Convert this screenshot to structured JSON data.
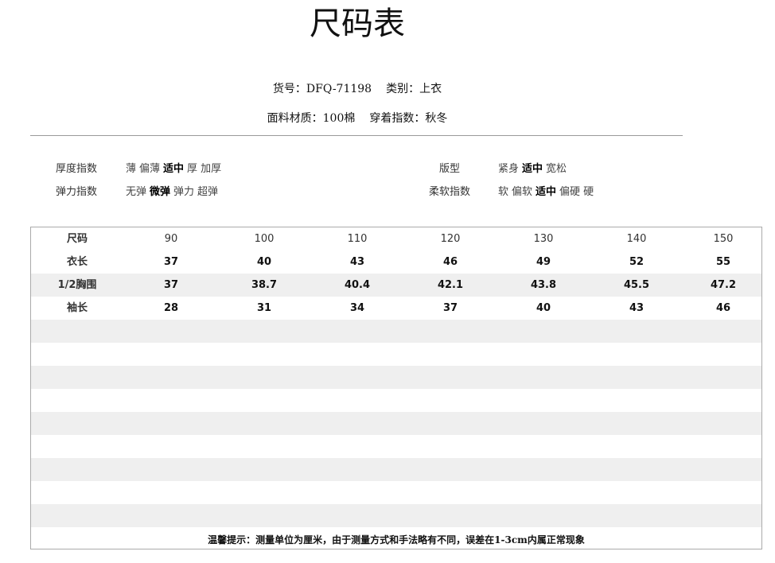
{
  "title": "尺码表",
  "info": {
    "item_no_label": "货号：",
    "item_no": "DFQ-71198",
    "category_label": "类别：",
    "category": "上衣",
    "fabric_label": "面料材质：",
    "fabric": "100棉",
    "season_label": "穿着指数：",
    "season": "秋冬"
  },
  "attributes": {
    "thickness": {
      "label": "厚度指数",
      "options": [
        "薄",
        "偏薄",
        "适中",
        "厚",
        "加厚"
      ],
      "selected": "适中"
    },
    "elasticity": {
      "label": "弹力指数",
      "options": [
        "无弹",
        "微弹",
        "弹力",
        "超弹"
      ],
      "selected": "微弹"
    },
    "fit": {
      "label": "版型",
      "options": [
        "紧身",
        "适中",
        "宽松"
      ],
      "selected": "适中"
    },
    "softness": {
      "label": "柔软指数",
      "options": [
        "软",
        "偏软",
        "适中",
        "偏硬",
        "硬"
      ],
      "selected": "适中"
    }
  },
  "size_table": {
    "header": [
      "尺码",
      "90",
      "100",
      "110",
      "120",
      "130",
      "140",
      "150"
    ],
    "rows": [
      [
        "衣长",
        "37",
        "40",
        "43",
        "46",
        "49",
        "52",
        "55"
      ],
      [
        "1/2胸围",
        "37",
        "38.7",
        "40.4",
        "42.1",
        "43.8",
        "45.5",
        "47.2"
      ],
      [
        "袖长",
        "28",
        "31",
        "34",
        "37",
        "40",
        "43",
        "46"
      ]
    ]
  },
  "footnote": "温馨提示：测量单位为厘米，由于测量方式和手法略有不同，误差在1-3cm内属正常现象"
}
